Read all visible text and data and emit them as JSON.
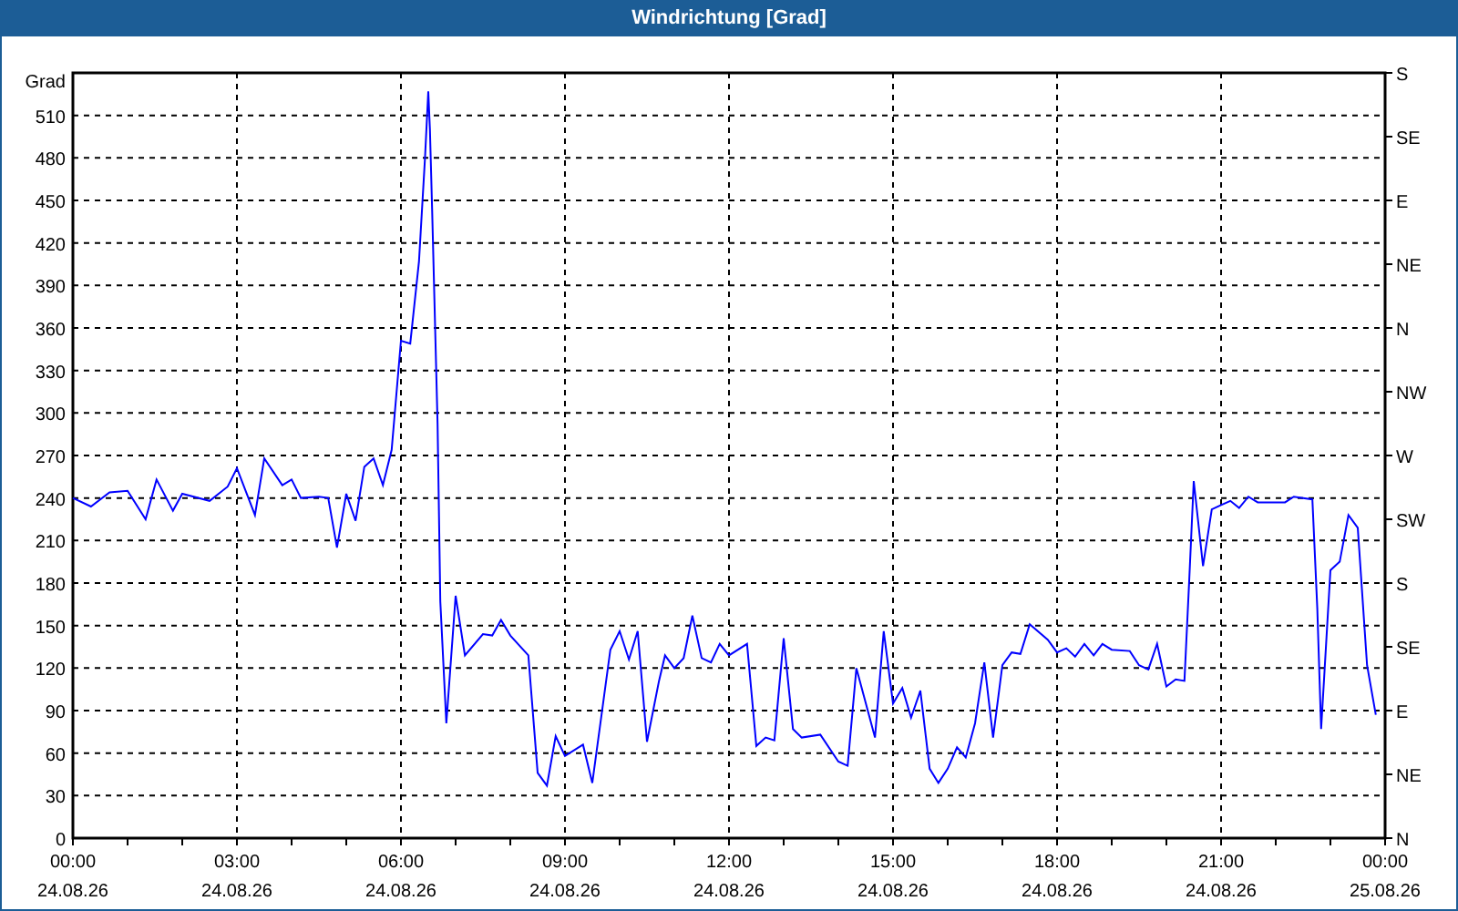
{
  "window": {
    "title": "Windrichtung [Grad]"
  },
  "chart": {
    "chart_data": {
      "type": "line",
      "ylabel": "Grad",
      "xlim": [
        0,
        24
      ],
      "ylim": [
        0,
        540
      ],
      "x": [
        0,
        0.33,
        0.67,
        1,
        1.33,
        1.53,
        1.83,
        2,
        2.5,
        2.83,
        3,
        3.33,
        3.5,
        3.83,
        4,
        4.17,
        4.5,
        4.67,
        4.83,
        5,
        5.17,
        5.33,
        5.5,
        5.67,
        5.83,
        6,
        6.17,
        6.33,
        6.44,
        6.5,
        6.53,
        6.57,
        6.67,
        6.72,
        6.83,
        7,
        7.17,
        7.5,
        7.67,
        7.83,
        8,
        8.33,
        8.5,
        8.67,
        8.83,
        9,
        9.33,
        9.5,
        9.83,
        10,
        10.17,
        10.33,
        10.5,
        10.72,
        10.83,
        11,
        11.17,
        11.33,
        11.5,
        11.67,
        11.83,
        12,
        12.33,
        12.5,
        12.67,
        12.83,
        13,
        13.17,
        13.33,
        13.67,
        14,
        14.17,
        14.33,
        14.67,
        14.83,
        15,
        15.17,
        15.33,
        15.5,
        15.67,
        15.83,
        16,
        16.17,
        16.33,
        16.5,
        16.67,
        16.83,
        17,
        17.17,
        17.33,
        17.5,
        17.83,
        18,
        18.17,
        18.33,
        18.5,
        18.67,
        18.83,
        19,
        19.33,
        19.5,
        19.67,
        19.83,
        20,
        20.17,
        20.33,
        20.42,
        20.5,
        20.67,
        20.83,
        21,
        21.17,
        21.33,
        21.5,
        21.67,
        22.17,
        22.33,
        22.67,
        22.76,
        22.83,
        23,
        23.17,
        23.33,
        23.5,
        23.67,
        23.83
      ],
      "grid": true,
      "series": [
        {
          "color": "#0000ff",
          "values": [
            240,
            234,
            244,
            245,
            225,
            253,
            231,
            243,
            238,
            248,
            261,
            228,
            268,
            249,
            253,
            240,
            241,
            240,
            205,
            243,
            224,
            262,
            268,
            249,
            274,
            351,
            349,
            407,
            480,
            527,
            500,
            444,
            292,
            167,
            81,
            171,
            129,
            144,
            143,
            154,
            143,
            129,
            46,
            37,
            72,
            58,
            66,
            39,
            133,
            146,
            126,
            146,
            68,
            111,
            129,
            120,
            127,
            157,
            127,
            124,
            137,
            129,
            137,
            65,
            71,
            69,
            141,
            77,
            71,
            73,
            54,
            51,
            120,
            71,
            146,
            95,
            106,
            85,
            104,
            49,
            39,
            49,
            64,
            57,
            81,
            124,
            71,
            122,
            131,
            130,
            151,
            140,
            131,
            134,
            128,
            137,
            129,
            137,
            133,
            132,
            122,
            119,
            137,
            107,
            112,
            111,
            184,
            252,
            192,
            232,
            235,
            238,
            233,
            241,
            237,
            237,
            241,
            239,
            162,
            77,
            189,
            195,
            228,
            219,
            122,
            87
          ]
        }
      ],
      "yticks": [
        {
          "value": 0,
          "label": "0"
        },
        {
          "value": 30,
          "label": "30"
        },
        {
          "value": 60,
          "label": "60"
        },
        {
          "value": 90,
          "label": "90"
        },
        {
          "value": 120,
          "label": "120"
        },
        {
          "value": 150,
          "label": "150"
        },
        {
          "value": 180,
          "label": "180"
        },
        {
          "value": 210,
          "label": "210"
        },
        {
          "value": 240,
          "label": "240"
        },
        {
          "value": 270,
          "label": "270"
        },
        {
          "value": 300,
          "label": "300"
        },
        {
          "value": 330,
          "label": "330"
        },
        {
          "value": 360,
          "label": "360"
        },
        {
          "value": 390,
          "label": "390"
        },
        {
          "value": 420,
          "label": "420"
        },
        {
          "value": 450,
          "label": "450"
        },
        {
          "value": 480,
          "label": "480"
        },
        {
          "value": 510,
          "label": "510"
        }
      ],
      "xticks": [
        {
          "value": 0,
          "label": "00:00"
        },
        {
          "value": 3,
          "label": "03:00"
        },
        {
          "value": 6,
          "label": "06:00"
        },
        {
          "value": 9,
          "label": "09:00"
        },
        {
          "value": 12,
          "label": "12:00"
        },
        {
          "value": 15,
          "label": "15:00"
        },
        {
          "value": 18,
          "label": "18:00"
        },
        {
          "value": 21,
          "label": "21:00"
        },
        {
          "value": 24,
          "label": "00:00"
        }
      ]
    },
    "x_dates": [
      "24.08.26",
      "24.08.26",
      "24.08.26",
      "24.08.26",
      "24.08.26",
      "24.08.26",
      "24.08.26",
      "24.08.26",
      "25.08.26"
    ],
    "right_ticks": [
      "S",
      "SE",
      "E",
      "NE",
      "N",
      "NW",
      "W",
      "SW",
      "S",
      "SE",
      "E",
      "NE",
      "N"
    ]
  }
}
